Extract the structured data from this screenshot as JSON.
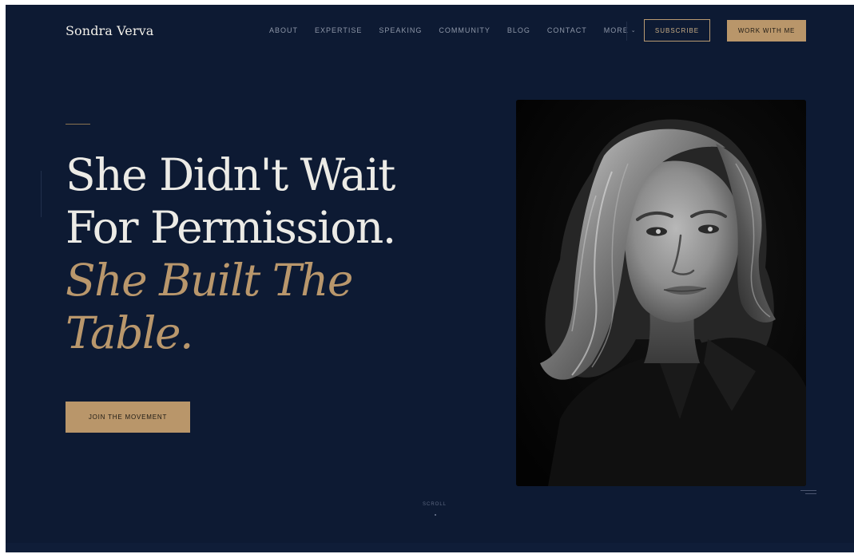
{
  "site": {
    "brand": "Sondra Verva"
  },
  "nav": {
    "items": [
      "ABOUT",
      "EXPERTISE",
      "SPEAKING",
      "COMMUNITY",
      "BLOG",
      "CONTACT"
    ],
    "more_label": "MORE",
    "subscribe_label": "SUBSCRIBE",
    "work_label": "WORK WITH ME"
  },
  "hero": {
    "headline_line1": "She Didn't Wait",
    "headline_line2": "For Permission.",
    "headline_line3": "She Built The",
    "headline_line4": "Table.",
    "cta_label": "JOIN THE MOVEMENT"
  },
  "scroll": {
    "label": "SCROLL"
  },
  "colors": {
    "background": "#0d1a33",
    "accent_gold": "#b9966a",
    "headline_white": "#ecebe6",
    "nav_text": "#8e97a8"
  },
  "icons": {
    "more": "chevron-down-icon"
  }
}
